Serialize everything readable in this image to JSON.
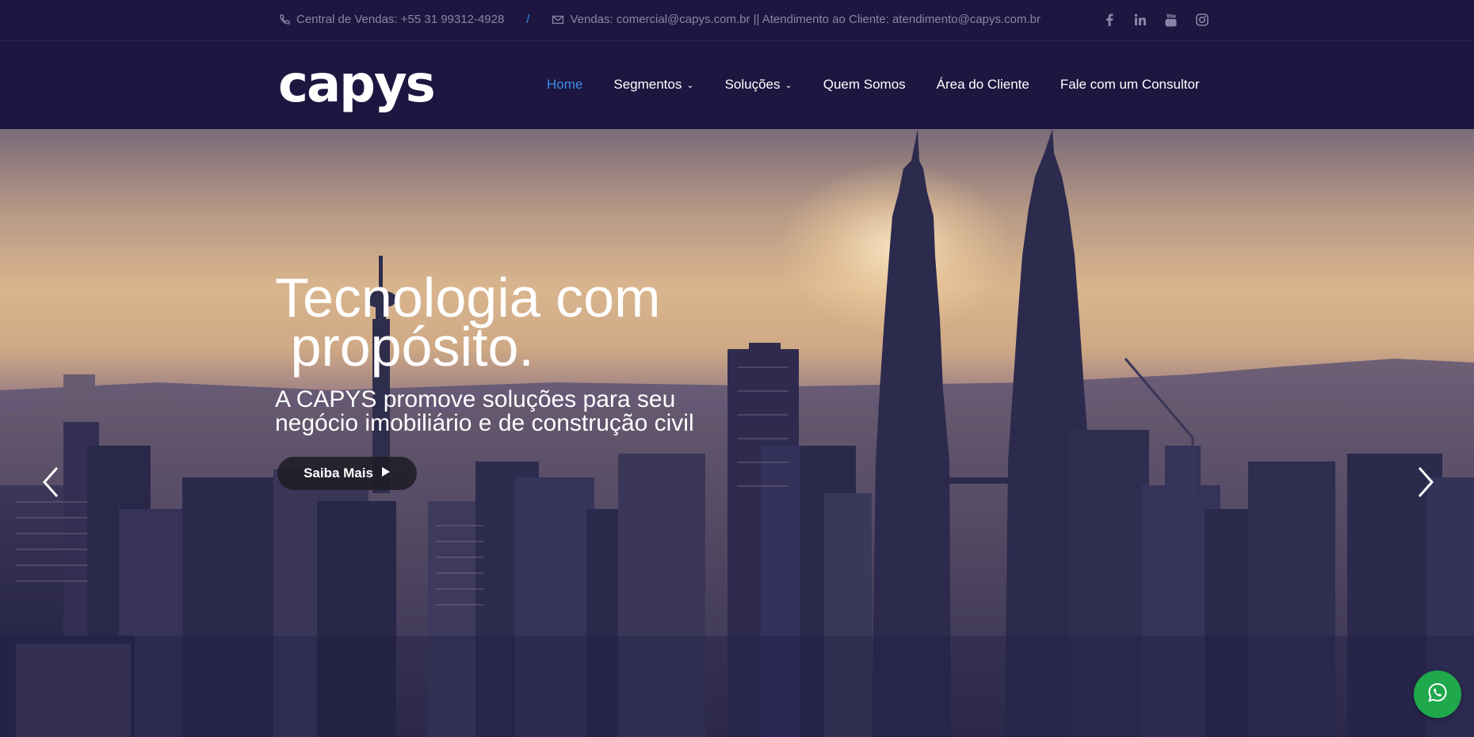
{
  "topbar": {
    "phone_icon": "phone-icon",
    "phone_text": "Central de Vendas: +55 31 99312-4928",
    "separator": "/",
    "mail_icon": "mail-icon",
    "mail_text": "Vendas: comercial@capys.com.br || Atendimento ao Cliente: atendimento@capys.com.br",
    "social": [
      "facebook-icon",
      "linkedin-icon",
      "youtube-icon",
      "instagram-icon"
    ]
  },
  "header": {
    "logo": "capys",
    "nav": [
      {
        "label": "Home",
        "active": true
      },
      {
        "label": "Segmentos",
        "dropdown": true
      },
      {
        "label": "Soluções",
        "dropdown": true
      },
      {
        "label": "Quem Somos"
      },
      {
        "label": "Área do Cliente"
      },
      {
        "label": "Fale com um Consultor"
      }
    ]
  },
  "hero": {
    "headline_line1": "Tecnologia com",
    "headline_line2": " propósito.",
    "subline": "A CAPYS promove soluções para seu negócio imobiliário e de construção civil",
    "cta_label": "Saiba Mais",
    "cta_icon": "play-icon",
    "prev_icon": "chevron-left-icon",
    "next_icon": "chevron-right-icon"
  },
  "whatsapp_icon": "whatsapp-icon",
  "colors": {
    "navy": "#1d1640",
    "accent": "#3a8ee6",
    "whatsapp": "#1fa84c"
  }
}
